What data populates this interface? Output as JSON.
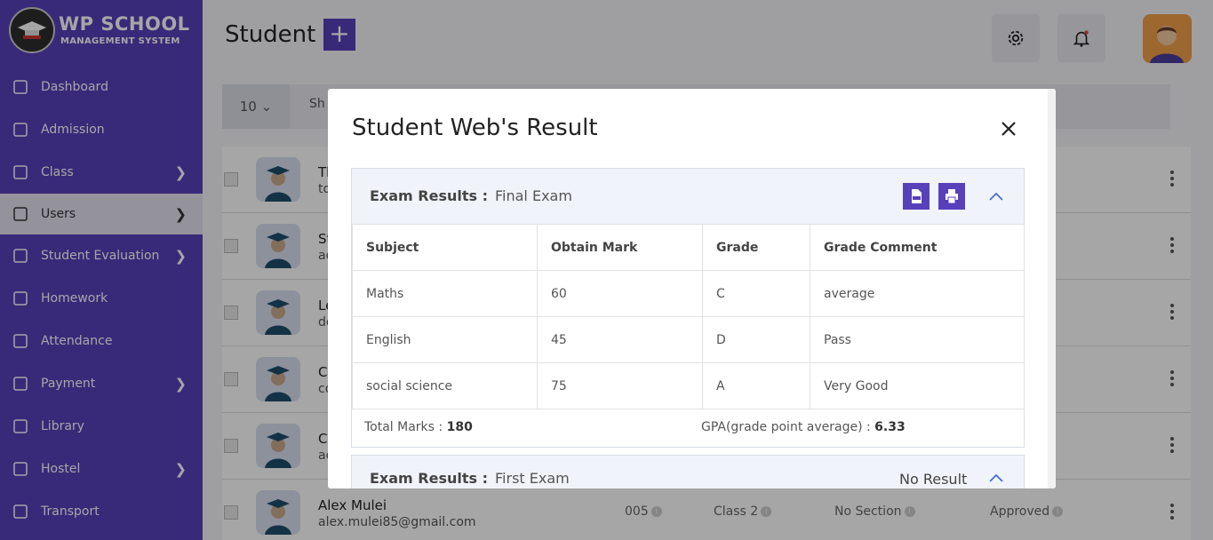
{
  "brand": {
    "title": "WP SCHOOL",
    "subtitle": "MANAGEMENT SYSTEM"
  },
  "sidebar": {
    "items": [
      {
        "label": "Dashboard",
        "icon": "dashboard-icon",
        "arrow": false
      },
      {
        "label": "Admission",
        "icon": "admission-icon",
        "arrow": false
      },
      {
        "label": "Class",
        "icon": "class-icon",
        "arrow": true
      },
      {
        "label": "Users",
        "icon": "users-icon",
        "arrow": true,
        "active": true
      },
      {
        "label": "Student Evaluation",
        "icon": "evaluation-icon",
        "arrow": true
      },
      {
        "label": "Homework",
        "icon": "homework-icon",
        "arrow": false
      },
      {
        "label": "Attendance",
        "icon": "attendance-icon",
        "arrow": false
      },
      {
        "label": "Payment",
        "icon": "payment-icon",
        "arrow": true
      },
      {
        "label": "Library",
        "icon": "library-icon",
        "arrow": false
      },
      {
        "label": "Hostel",
        "icon": "hostel-icon",
        "arrow": true
      },
      {
        "label": "Transport",
        "icon": "transport-icon",
        "arrow": false
      }
    ]
  },
  "header": {
    "title": "Student",
    "add_label": "+"
  },
  "toolbar": {
    "per_page": "10",
    "show_label": "Sh"
  },
  "rows": [
    {
      "name": "Th",
      "email": "to"
    },
    {
      "name": "St",
      "email": "ac"
    },
    {
      "name": "Le",
      "email": "de"
    },
    {
      "name": "C",
      "email": "co"
    },
    {
      "name": "C",
      "email": "ac"
    },
    {
      "name": "Alex Mulei",
      "email": "alex.mulei85@gmail.com",
      "roll": "005",
      "class": "Class 2",
      "section": "No Section",
      "status": "Approved"
    }
  ],
  "modal": {
    "title": "Student Web's Result",
    "exam_label": "Exam Results :",
    "exams": [
      {
        "name": "Final Exam",
        "columns": [
          "Subject",
          "Obtain Mark",
          "Grade",
          "Grade Comment"
        ],
        "rows": [
          [
            "Maths",
            "60",
            "C",
            "average"
          ],
          [
            "English",
            "45",
            "D",
            "Pass"
          ],
          [
            "social science",
            "75",
            "A",
            "Very Good"
          ]
        ],
        "total_label": "Total Marks : ",
        "total_value": "180",
        "gpa_label": "GPA(grade point average) : ",
        "gpa_value": "6.33"
      },
      {
        "name": "First Exam",
        "status": "No Result"
      }
    ]
  },
  "colors": {
    "primary": "#5840bb",
    "sidebar_active": "#e3e0ee"
  }
}
